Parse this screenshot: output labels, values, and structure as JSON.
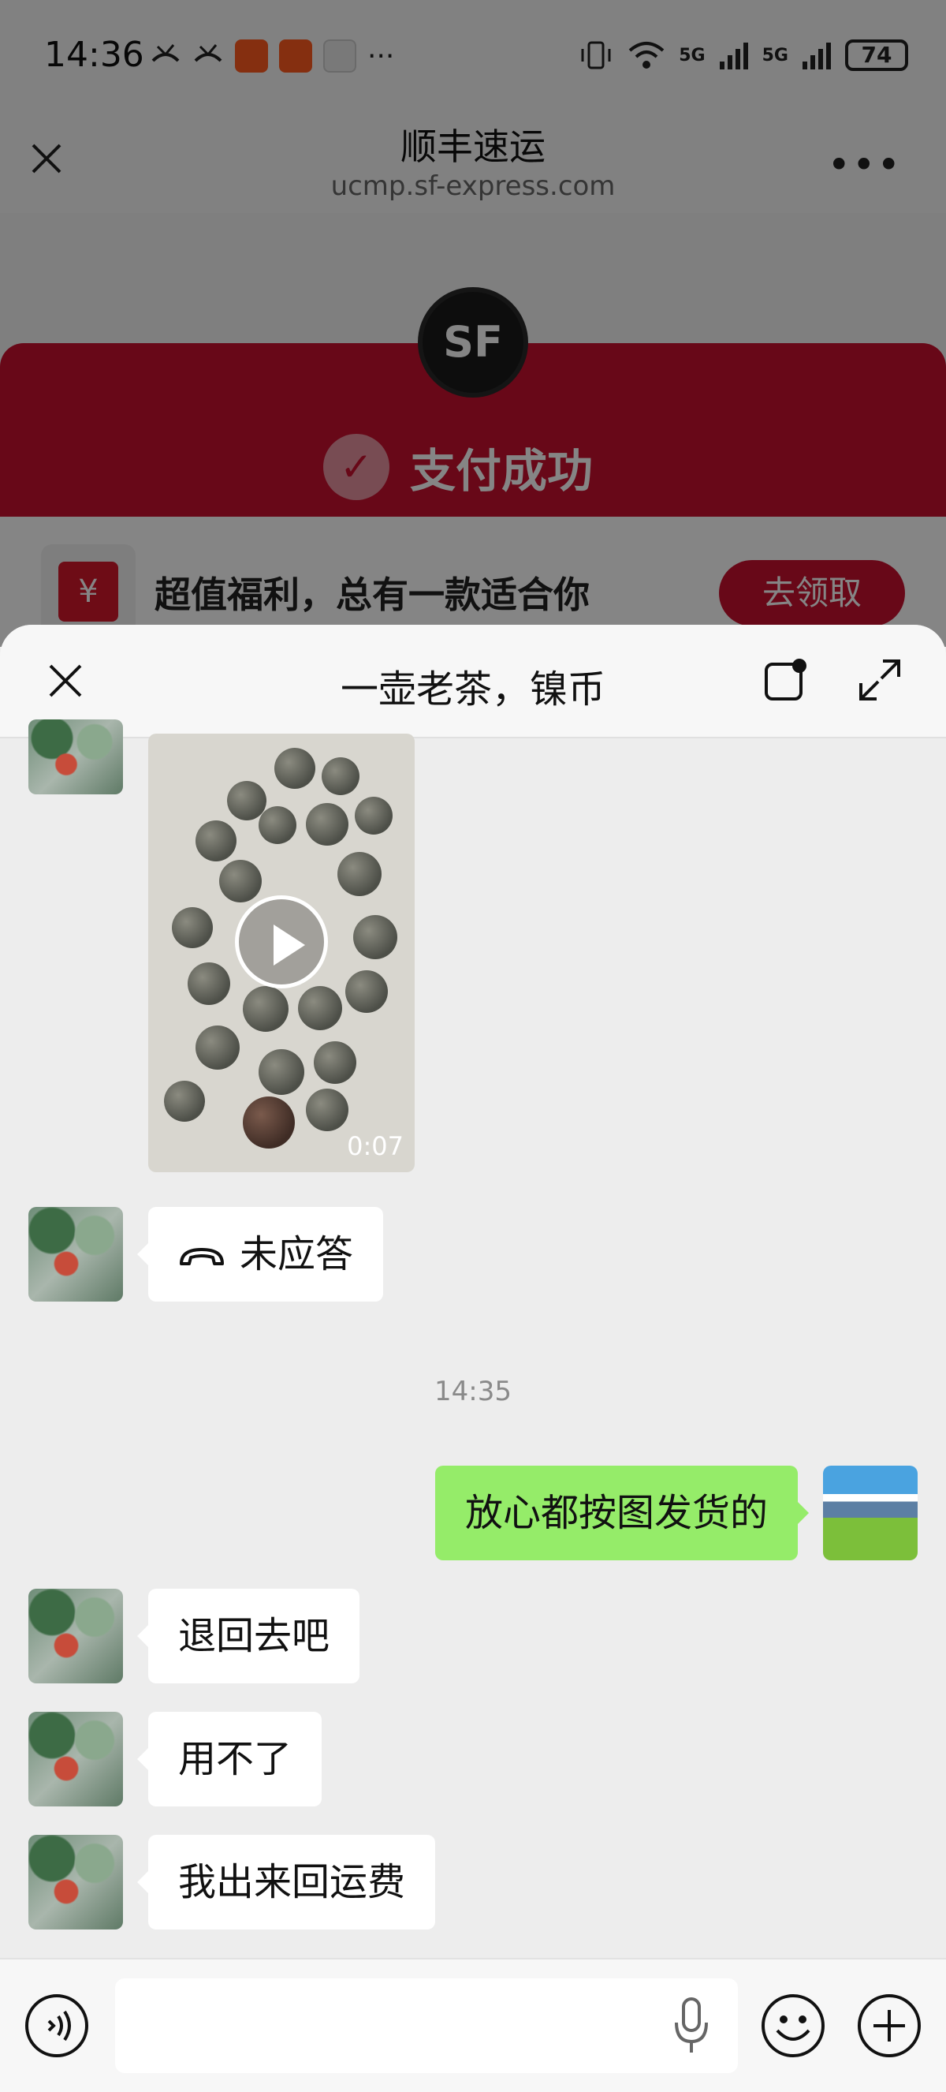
{
  "status_bar": {
    "time": "14:36",
    "battery": "74",
    "signal_label_1": "5G",
    "signal_label_2": "5G"
  },
  "browser": {
    "title": "顺丰速运",
    "url": "ucmp.sf-express.com",
    "more": "•••"
  },
  "sf_page": {
    "logo": "SF",
    "pay_status": "支付成功",
    "promo_icon": "¥",
    "promo_text": "超值福利，总有一款适合你",
    "promo_button": "去领取"
  },
  "chat": {
    "title": "一壶老茶，镍币",
    "video_duration": "0:07",
    "missed_call": "未应答",
    "timestamp": "14:35",
    "messages": [
      {
        "from": "me",
        "text": "放心都按图发货的"
      },
      {
        "from": "other",
        "text": "退回去吧"
      },
      {
        "from": "other",
        "text": "用不了"
      },
      {
        "from": "other",
        "text": "我出来回运费"
      }
    ]
  },
  "input_bar": {
    "placeholder": ""
  },
  "colors": {
    "sf_red": "#c8102e",
    "my_bubble": "#95ec69",
    "other_bubble": "#ffffff",
    "chat_bg": "#ededed"
  }
}
